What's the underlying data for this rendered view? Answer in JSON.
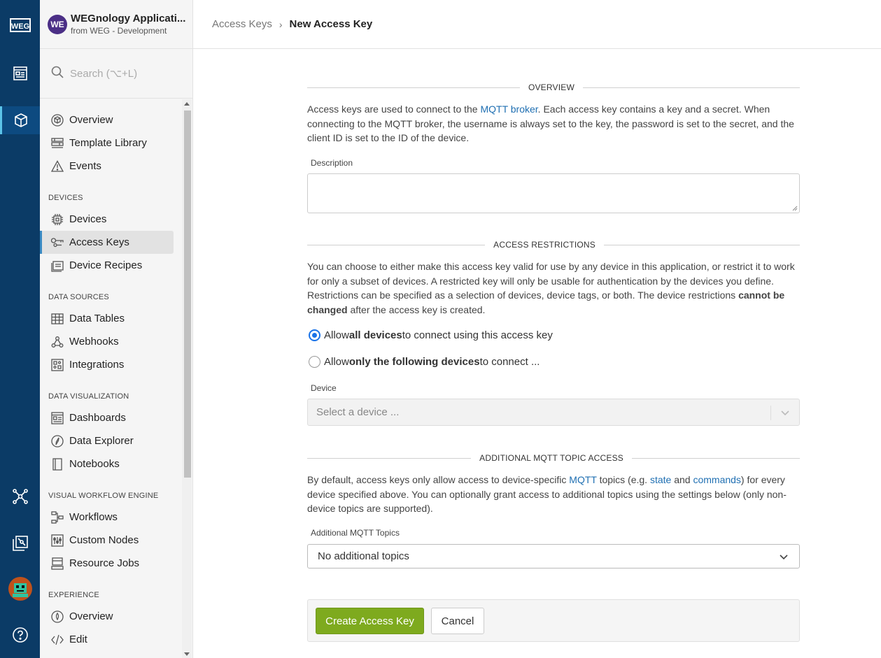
{
  "rail": {
    "logo_icon": "weg-logo-icon",
    "items": [
      {
        "icon": "dashboard-icon"
      },
      {
        "icon": "application-cube-icon"
      },
      {
        "icon": "integrations-network-icon"
      },
      {
        "icon": "stacked-apps-icon"
      },
      {
        "icon": "user-avatar-icon"
      },
      {
        "icon": "help-icon"
      }
    ]
  },
  "app": {
    "avatar": "WE",
    "name": "WEGnology Applicati...",
    "subtitle": "from WEG - Development"
  },
  "search": {
    "placeholder": "Search (⌥+L)"
  },
  "sidebar": {
    "top_items": [
      {
        "label": "Overview",
        "icon": "cube-circle-icon"
      },
      {
        "label": "Template Library",
        "icon": "library-icon"
      },
      {
        "label": "Events",
        "icon": "warning-icon"
      }
    ],
    "sections": [
      {
        "title": "DEVICES",
        "items": [
          {
            "label": "Devices",
            "icon": "chip-icon"
          },
          {
            "label": "Access Keys",
            "icon": "key-icon",
            "active": true
          },
          {
            "label": "Device Recipes",
            "icon": "recipe-icon"
          }
        ]
      },
      {
        "title": "DATA SOURCES",
        "items": [
          {
            "label": "Data Tables",
            "icon": "table-icon"
          },
          {
            "label": "Webhooks",
            "icon": "webhook-icon"
          },
          {
            "label": "Integrations",
            "icon": "puzzle-icon"
          }
        ]
      },
      {
        "title": "DATA VISUALIZATION",
        "items": [
          {
            "label": "Dashboards",
            "icon": "dashboard-icon"
          },
          {
            "label": "Data Explorer",
            "icon": "compass-icon"
          },
          {
            "label": "Notebooks",
            "icon": "notebook-icon"
          }
        ]
      },
      {
        "title": "VISUAL WORKFLOW ENGINE",
        "items": [
          {
            "label": "Workflows",
            "icon": "workflow-icon"
          },
          {
            "label": "Custom Nodes",
            "icon": "sliders-icon"
          },
          {
            "label": "Resource Jobs",
            "icon": "server-icon"
          }
        ]
      },
      {
        "title": "EXPERIENCE",
        "items": [
          {
            "label": "Overview",
            "icon": "experience-icon"
          },
          {
            "label": "Edit",
            "icon": "code-icon"
          }
        ]
      }
    ]
  },
  "breadcrumb": {
    "parent": "Access Keys",
    "separator": "›",
    "current": "New Access Key"
  },
  "form": {
    "overview": {
      "heading": "OVERVIEW",
      "text_1": "Access keys are used to connect to the ",
      "link": "MQTT broker",
      "text_2": ". Each access key contains a key and a secret. When connecting to the MQTT broker, the username is always set to the key, the password is set to the secret, and the client ID is set to the ID of the device.",
      "description_label": "Description",
      "description_value": ""
    },
    "restrictions": {
      "heading": "ACCESS RESTRICTIONS",
      "text_1": "You can choose to either make this access key valid for use by any device in this application, or restrict it to work for only a subset of devices. A restricted key will only be usable for authentication by the devices you define. Restrictions can be specified as a selection of devices, device tags, or both. The device restrictions ",
      "bold": "cannot be changed",
      "text_2": " after the access key is created.",
      "radio_all": {
        "pre": "Allow ",
        "bold": "all devices",
        "post": " to connect using this access key",
        "checked": true
      },
      "radio_some": {
        "pre": "Allow ",
        "bold": "only the following devices",
        "post": " to connect ...",
        "checked": false
      },
      "device_label": "Device",
      "device_placeholder": "Select a device ..."
    },
    "mqtt": {
      "heading": "ADDITIONAL MQTT TOPIC ACCESS",
      "text_1": "By default, access keys only allow access to device-specific ",
      "link_1": "MQTT",
      "text_2": " topics (e.g. ",
      "link_2": "state",
      "text_3": " and ",
      "link_3": "commands",
      "text_4": ") for every device specified above. You can optionally grant access to additional topics using the settings below (only non-device topics are supported).",
      "topics_label": "Additional MQTT Topics",
      "topics_value": "No additional topics"
    },
    "actions": {
      "create": "Create Access Key",
      "cancel": "Cancel"
    }
  },
  "colors": {
    "rail": "#0b3b66",
    "primary_button": "#7eaa1e",
    "link": "#1f6fb2",
    "radio": "#1a73e8"
  }
}
